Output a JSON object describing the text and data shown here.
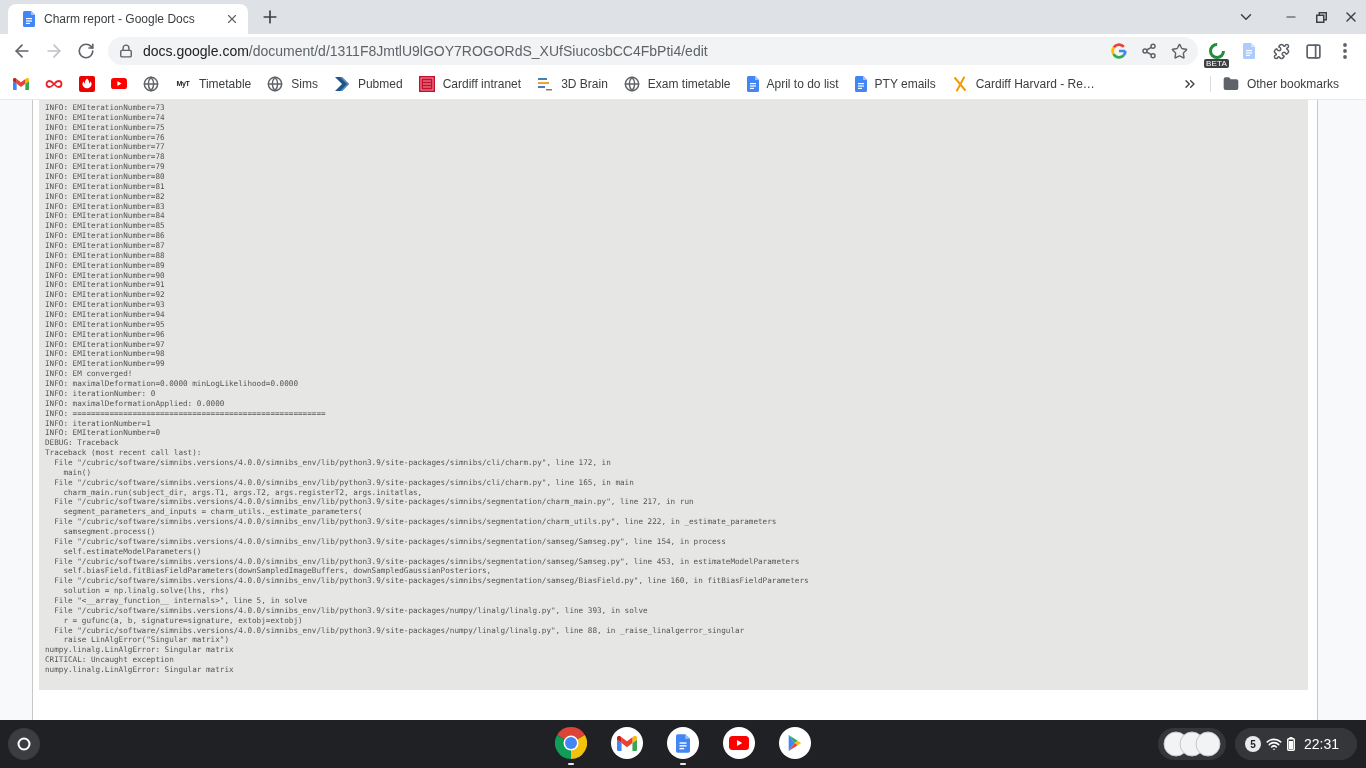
{
  "window": {
    "tabs": [
      {
        "title": "Charm report - Google Docs",
        "selected": true
      }
    ]
  },
  "toolbar": {
    "forward_disabled": true,
    "address": {
      "domain": "docs.google.com",
      "path": "/document/d/1311F8JmtlU9lGOY7ROGORdS_XUfSiucosbCC4FbPti4/edit"
    },
    "extension_badge": "BETA"
  },
  "bookmarks": {
    "items": [
      {
        "kind": "favicon_only"
      },
      {
        "kind": "favicon_only"
      },
      {
        "kind": "favicon_only"
      },
      {
        "kind": "favicon_only"
      },
      {
        "kind": "favicon_only"
      },
      {
        "kind": "labeled",
        "icon_text": "MyT",
        "label": "Timetable"
      },
      {
        "kind": "labeled",
        "label": "Sims"
      },
      {
        "kind": "labeled",
        "label": "Pubmed"
      },
      {
        "kind": "labeled",
        "label": "Cardiff intranet"
      },
      {
        "kind": "labeled",
        "label": "3D Brain"
      },
      {
        "kind": "labeled",
        "label": "Exam timetable"
      },
      {
        "kind": "labeled",
        "label": "April to do list"
      },
      {
        "kind": "labeled",
        "label": "PTY emails"
      },
      {
        "kind": "labeled",
        "label": "Cardiff Harvard - Re…"
      }
    ],
    "other_bookmarks": "Other bookmarks"
  },
  "document": {
    "log_lines": [
      "INFO: EMIterationNumber=73",
      "INFO: EMIterationNumber=74",
      "INFO: EMIterationNumber=75",
      "INFO: EMIterationNumber=76",
      "INFO: EMIterationNumber=77",
      "INFO: EMIterationNumber=78",
      "INFO: EMIterationNumber=79",
      "INFO: EMIterationNumber=80",
      "INFO: EMIterationNumber=81",
      "INFO: EMIterationNumber=82",
      "INFO: EMIterationNumber=83",
      "INFO: EMIterationNumber=84",
      "INFO: EMIterationNumber=85",
      "INFO: EMIterationNumber=86",
      "INFO: EMIterationNumber=87",
      "INFO: EMIterationNumber=88",
      "INFO: EMIterationNumber=89",
      "INFO: EMIterationNumber=90",
      "INFO: EMIterationNumber=91",
      "INFO: EMIterationNumber=92",
      "INFO: EMIterationNumber=93",
      "INFO: EMIterationNumber=94",
      "INFO: EMIterationNumber=95",
      "INFO: EMIterationNumber=96",
      "INFO: EMIterationNumber=97",
      "INFO: EMIterationNumber=98",
      "INFO: EMIterationNumber=99",
      "INFO: EM converged!",
      "INFO: maximalDeformation=0.0000 minLogLikelihood=0.0000",
      "INFO: iterationNumber: 0",
      "INFO: maximalDeformationApplied: 0.0000",
      "INFO: =======================================================",
      "INFO: iterationNumber=1",
      "INFO: EMIterationNumber=0",
      "DEBUG: Traceback",
      "Traceback (most recent call last):",
      "  File \"/cubric/software/simnibs.versions/4.0.0/simnibs_env/lib/python3.9/site-packages/simnibs/cli/charm.py\", line 172, in",
      "    main()",
      "  File \"/cubric/software/simnibs.versions/4.0.0/simnibs_env/lib/python3.9/site-packages/simnibs/cli/charm.py\", line 165, in main",
      "    charm_main.run(subject_dir, args.T1, args.T2, args.registerT2, args.initatlas,",
      "  File \"/cubric/software/simnibs.versions/4.0.0/simnibs_env/lib/python3.9/site-packages/simnibs/segmentation/charm_main.py\", line 217, in run",
      "    segment_parameters_and_inputs = charm_utils._estimate_parameters(",
      "  File \"/cubric/software/simnibs.versions/4.0.0/simnibs_env/lib/python3.9/site-packages/simnibs/segmentation/charm_utils.py\", line 222, in _estimate_parameters",
      "    samsegment.process()",
      "  File \"/cubric/software/simnibs.versions/4.0.0/simnibs_env/lib/python3.9/site-packages/simnibs/segmentation/samseg/Samseg.py\", line 154, in process",
      "    self.estimateModelParameters()",
      "  File \"/cubric/software/simnibs.versions/4.0.0/simnibs_env/lib/python3.9/site-packages/simnibs/segmentation/samseg/Samseg.py\", line 453, in estimateModelParameters",
      "    self.biasField.fitBiasFieldParameters(downSampledImageBuffers, downSampledGaussianPosteriors,",
      "  File \"/cubric/software/simnibs.versions/4.0.0/simnibs_env/lib/python3.9/site-packages/simnibs/segmentation/samseg/BiasField.py\", line 160, in fitBiasFieldParameters",
      "    solution = np.linalg.solve(lhs, rhs)",
      "  File \"<__array_function__ internals>\", line 5, in solve",
      "  File \"/cubric/software/simnibs.versions/4.0.0/simnibs_env/lib/python3.9/site-packages/numpy/linalg/linalg.py\", line 393, in solve",
      "    r = gufunc(a, b, signature=signature, extobj=extobj)",
      "  File \"/cubric/software/simnibs.versions/4.0.0/simnibs_env/lib/python3.9/site-packages/numpy/linalg/linalg.py\", line 88, in _raise_linalgerror_singular",
      "    raise LinAlgError(\"Singular matrix\")",
      "numpy.linalg.LinAlgError: Singular matrix",
      "CRITICAL: Uncaught exception",
      "numpy.linalg.LinAlgError: Singular matrix"
    ]
  },
  "shelf": {
    "apps": [
      {
        "running": true
      },
      {
        "running": false
      },
      {
        "running": true
      },
      {
        "running": false
      },
      {
        "running": false
      }
    ],
    "notification_count": "5",
    "time": "22:31"
  }
}
